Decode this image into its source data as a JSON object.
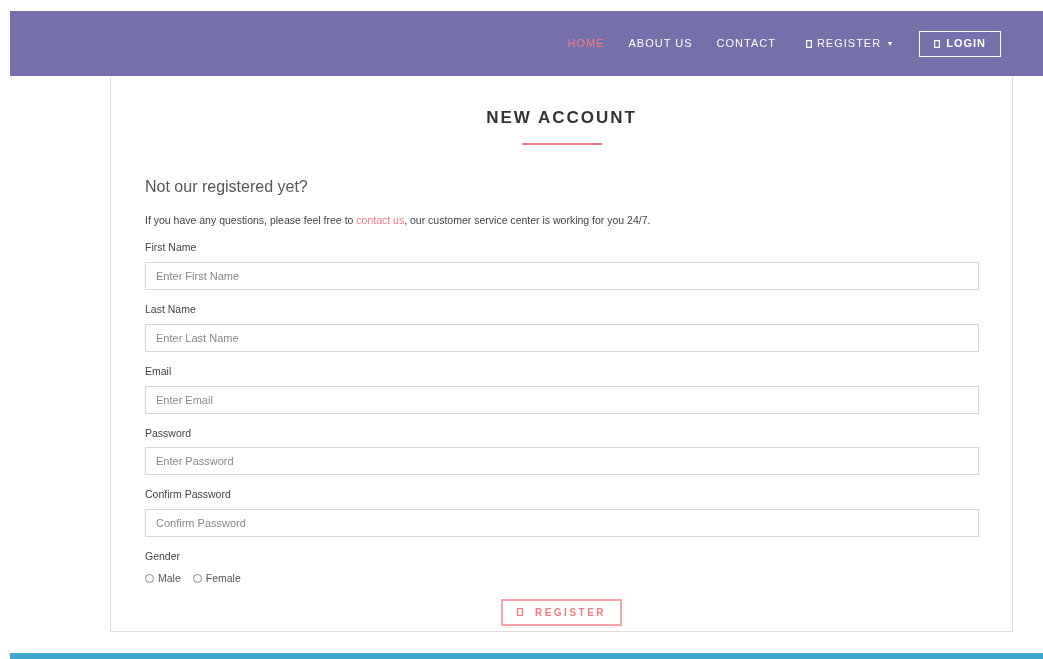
{
  "nav": {
    "items": [
      {
        "label": "HOME",
        "selected": true
      },
      {
        "label": "ABOUT US",
        "selected": false
      },
      {
        "label": "CONTACT",
        "selected": false
      }
    ],
    "register": {
      "label": "REGISTER",
      "caret": "▾"
    },
    "login": {
      "label": "LOGIN"
    }
  },
  "form": {
    "title": "NEW ACCOUNT",
    "heading": "Not our registered yet?",
    "intro": {
      "before": "If you have any questions, please feel free to ",
      "link": "contact us",
      "after": ", our customer service center is working for you 24/7."
    },
    "fields": [
      {
        "label": "First Name",
        "placeholder": "Enter First Name"
      },
      {
        "label": "Last Name",
        "placeholder": "Enter Last Name"
      },
      {
        "label": "Email",
        "placeholder": "Enter Email"
      },
      {
        "label": "Password",
        "placeholder": "Enter Password"
      },
      {
        "label": "Confirm Password",
        "placeholder": "Confirm Password"
      }
    ],
    "gender": {
      "label": "Gender",
      "options": [
        {
          "label": "Male",
          "selected": false
        },
        {
          "label": "Female",
          "selected": false
        }
      ]
    },
    "submit": {
      "label": "REGISTER"
    }
  }
}
